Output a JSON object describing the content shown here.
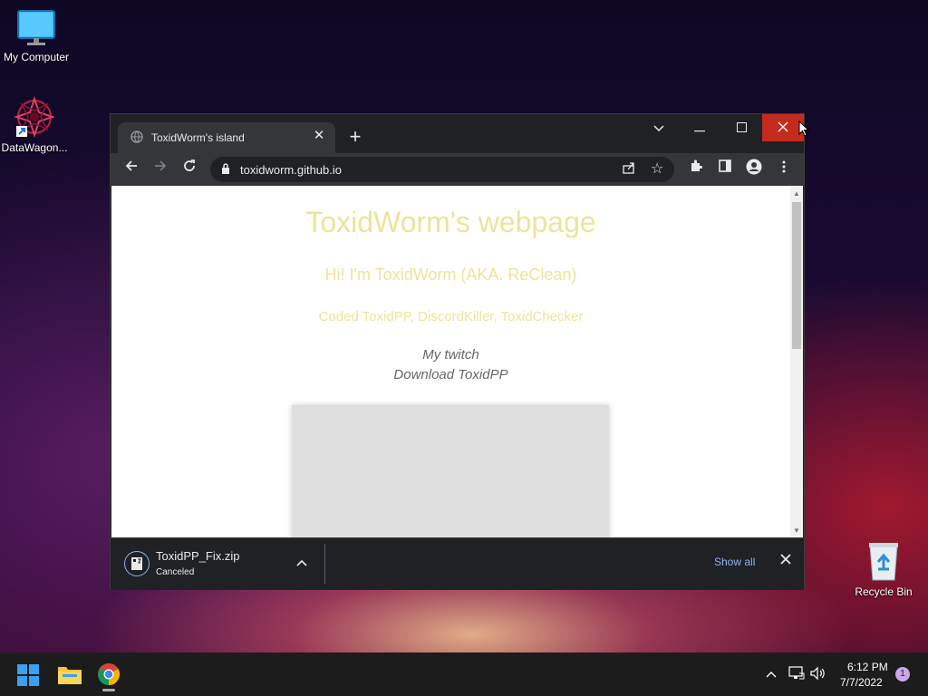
{
  "desktop": {
    "icons": [
      {
        "label": "My Computer"
      },
      {
        "label": "DataWagon..."
      },
      {
        "label": "Recycle Bin"
      }
    ]
  },
  "browser": {
    "tab": {
      "title": "ToxidWorm's island"
    },
    "address": {
      "url": "toxidworm.github.io"
    },
    "page": {
      "heading": "ToxidWorm's webpage",
      "subheading": "Hi! I'm ToxidWorm (AKA. ReClean)",
      "coded": "Coded ToxidPP, DiscordKiller, ToxidChecker",
      "link_twitch": "My twitch",
      "link_download": "Download ToxidPP"
    },
    "download": {
      "filename": "ToxidPP_Fix.zip",
      "status": "Canceled",
      "show_all": "Show all"
    }
  },
  "taskbar": {
    "time": "6:12 PM",
    "date": "7/7/2022",
    "notification_count": "1"
  },
  "colors": {
    "accent_link": "#8ab4f8",
    "page_heading": "#ede49a",
    "close_button": "#c42b1c"
  }
}
